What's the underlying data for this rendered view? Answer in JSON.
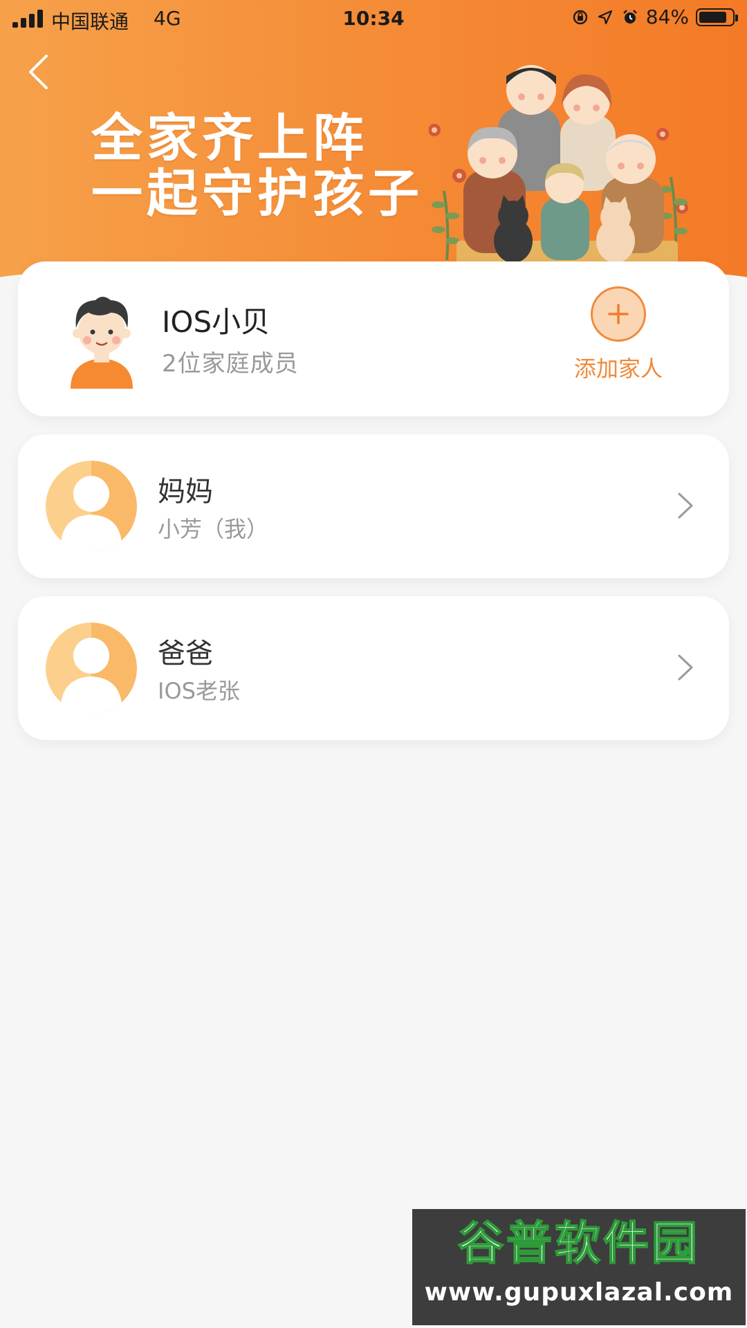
{
  "status_bar": {
    "carrier": "中国联通",
    "network": "4G",
    "time": "10:34",
    "battery_percent": "84%",
    "battery_level": 0.84,
    "icons": [
      "orientation-lock-icon",
      "location-icon",
      "alarm-icon"
    ]
  },
  "header": {
    "back_icon": "chevron-left-icon",
    "slogan_line1": "全家齐上阵",
    "slogan_line2": "一起守护孩子"
  },
  "family": {
    "child_name": "IOS小贝",
    "member_count_text": "2位家庭成员",
    "add_button_label": "添加家人"
  },
  "members": [
    {
      "role": "妈妈",
      "name": "小芳（我）"
    },
    {
      "role": "爸爸",
      "name": "IOS老张"
    }
  ],
  "watermark": {
    "logo_text": "谷普软件园",
    "url": "www.gupuxlazal.com"
  },
  "colors": {
    "accent": "#f08a3c",
    "banner_start": "#f6a14a",
    "banner_end": "#f47a27",
    "background": "#f6f6f6",
    "avatar_light": "#fcd08c",
    "avatar_dark": "#f5a54a"
  }
}
